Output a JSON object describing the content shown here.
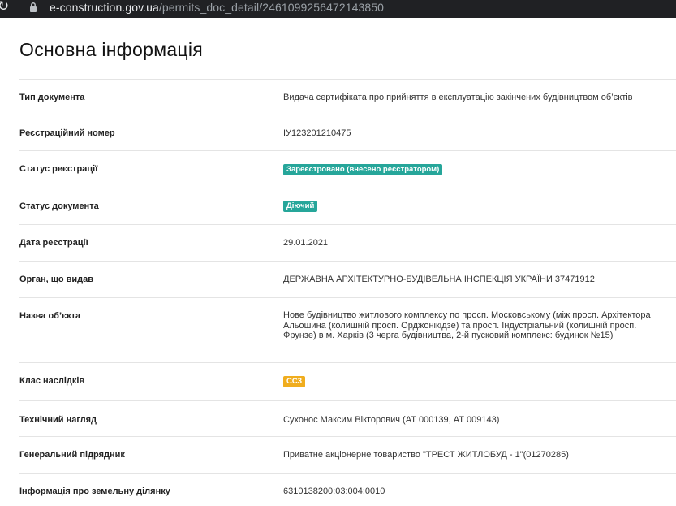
{
  "browser": {
    "url_host": "e-construction.gov.ua",
    "url_path": "/permits_doc_detail/2461099256472143850"
  },
  "page": {
    "title": "Основна інформація"
  },
  "rows": [
    {
      "label": "Тип документа",
      "value": "Видача сертифіката про прийняття в експлуатацію закінчених будівництвом об’єктів"
    },
    {
      "label": "Реєстраційний номер",
      "value": "ІУ123201210475"
    },
    {
      "label": "Статус реєстрації",
      "badge": "Зареєстровано (внесено реєстратором)",
      "badge_color": "#26a69a"
    },
    {
      "label": "Статус документа",
      "badge": "Діючий",
      "badge_color": "#26a69a"
    },
    {
      "label": "Дата реєстрації",
      "value": "29.01.2021"
    },
    {
      "label": "Орган, що видав",
      "value": "ДЕРЖАВНА АРХІТЕКТУРНО-БУДІВЕЛЬНА ІНСПЕКЦІЯ УКРАЇНИ 37471912"
    },
    {
      "label": "Назва об’єкта",
      "value": "Нове будівництво житлового комплексу по просп. Московському (між просп. Архітектора Альошина (колишній просп. Орджонікідзе) та просп. Індустріальний (колишній просп. Фрунзе) в м. Харків (3 черга будівництва, 2-й пусковий комплекс: будинок №15)"
    },
    {
      "label": "Клас наслідків",
      "badge": "СС3",
      "badge_color": "#f0ad1e"
    },
    {
      "label": "Технічний нагляд",
      "value": "Сухонос Максим Вікторович (АТ 000139, АТ 009143)"
    },
    {
      "label": "Генеральний підрядник",
      "value": "Приватне акціонерне товариство \"ТРЕСТ ЖИТЛОБУД - 1\"(01270285)"
    },
    {
      "label": "Інформація про земельну ділянку",
      "value": "6310138200:03:004:0010"
    }
  ]
}
